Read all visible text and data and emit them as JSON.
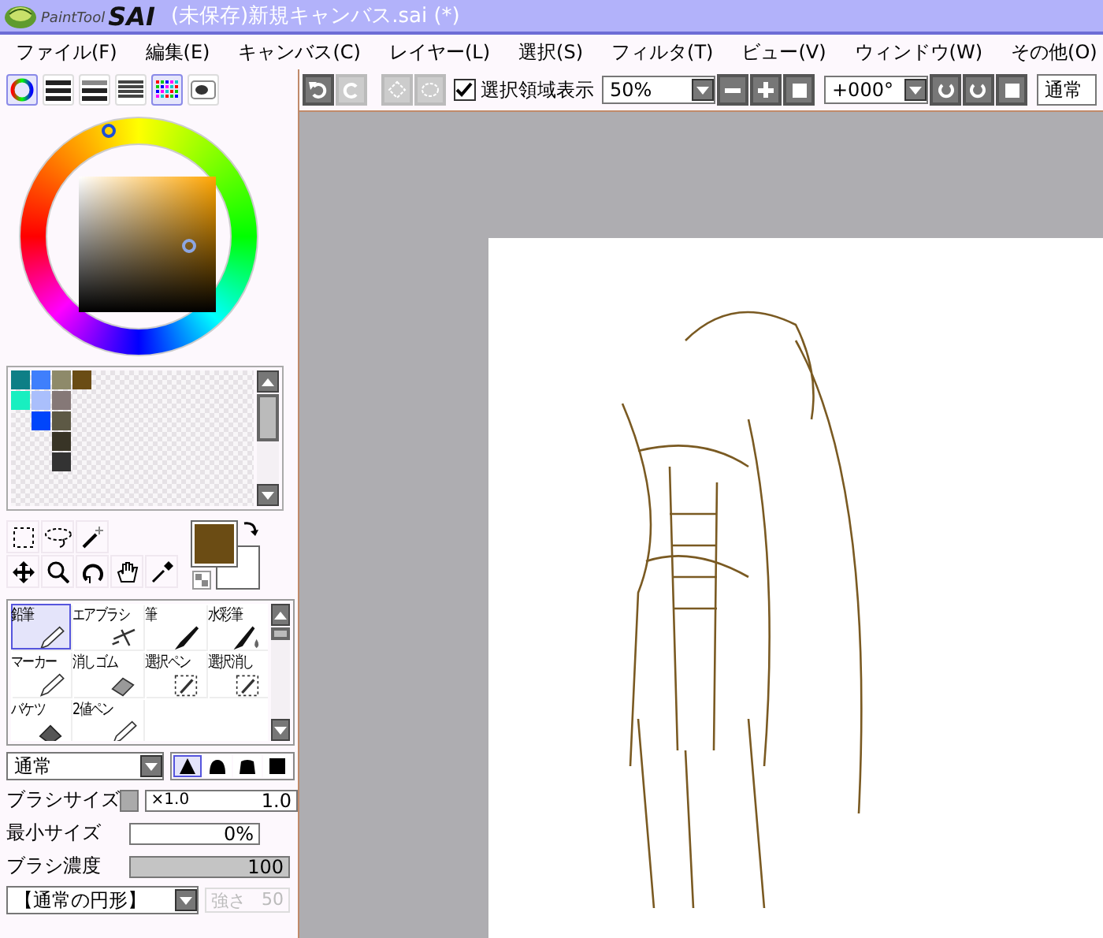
{
  "window": {
    "title": "(未保存)新規キャンバス.sai (*)",
    "logo_small": "PaintTool",
    "logo_large": "SAI"
  },
  "menu": [
    "ファイル(F)",
    "編集(E)",
    "キャンバス(C)",
    "レイヤー(L)",
    "選択(S)",
    "フィルタ(T)",
    "ビュー(V)",
    "ウィンドウ(W)",
    "その他(O)"
  ],
  "panel_tabs": [
    {
      "kind": "wheel",
      "selected": true
    },
    {
      "kind": "rgb",
      "selected": false
    },
    {
      "kind": "hsv",
      "selected": false
    },
    {
      "kind": "mixer",
      "selected": false
    },
    {
      "kind": "swatches",
      "selected": true
    },
    {
      "kind": "scratch",
      "selected": false
    }
  ],
  "palette": [
    [
      {
        "kind": "swatch",
        "color": "#0e7f86"
      },
      {
        "kind": "swatch",
        "color": "#3f7ffc"
      },
      {
        "kind": "swatch",
        "color": "#8e8a6a"
      },
      {
        "kind": "swatch",
        "color": "#6a4c14"
      }
    ],
    [
      {
        "kind": "swatch",
        "color": "#18efc0"
      },
      {
        "kind": "swatch",
        "color": "#aabffc"
      },
      {
        "kind": "swatch",
        "color": "#857877"
      }
    ],
    [
      {
        "kind": "empty"
      },
      {
        "kind": "swatch",
        "color": "#0045fb"
      },
      {
        "kind": "swatch",
        "color": "#5d5945"
      }
    ],
    [
      {
        "kind": "empty"
      },
      {
        "kind": "empty"
      },
      {
        "kind": "swatch",
        "color": "#383426"
      }
    ],
    [
      {
        "kind": "empty"
      },
      {
        "kind": "empty"
      },
      {
        "kind": "swatch",
        "color": "#333333"
      }
    ]
  ],
  "tools": [
    {
      "kind": "rect-select"
    },
    {
      "kind": "lasso"
    },
    {
      "kind": "wand"
    },
    {
      "kind": "empty"
    },
    {
      "kind": "empty"
    },
    {
      "kind": "move"
    },
    {
      "kind": "zoom"
    },
    {
      "kind": "rotate"
    },
    {
      "kind": "hand"
    },
    {
      "kind": "eyedropper"
    }
  ],
  "brushes": [
    {
      "label": "鉛筆",
      "kind": "pencil",
      "selected": true
    },
    {
      "label": "エアブラシ",
      "kind": "airbrush",
      "selected": false
    },
    {
      "label": "筆",
      "kind": "brush",
      "selected": false
    },
    {
      "label": "水彩筆",
      "kind": "watercolor",
      "selected": false
    },
    {
      "label": "マーカー",
      "kind": "pencil",
      "selected": false
    },
    {
      "label": "消しゴム",
      "kind": "eraser",
      "selected": false
    },
    {
      "label": "選択ペン",
      "kind": "selpen",
      "selected": false
    },
    {
      "label": "選択消し",
      "kind": "selerase",
      "selected": false
    },
    {
      "label": "バケツ",
      "kind": "bucket",
      "selected": false
    },
    {
      "label": "2値ペン",
      "kind": "pencil",
      "selected": false
    }
  ],
  "blend_mode": "通常",
  "brush_shapes": [
    {
      "selected": true
    },
    {
      "selected": false
    },
    {
      "selected": false
    },
    {
      "selected": false
    }
  ],
  "brush_size": {
    "label": "ブラシサイズ",
    "multiplier": "×1.0",
    "value": "1.0"
  },
  "min_size": {
    "label": "最小サイズ",
    "value": "0%",
    "level": 0
  },
  "density": {
    "label": "ブラシ濃度",
    "value": "100",
    "level": 1
  },
  "shape": {
    "value": "【通常の円形】",
    "strength_label": "強さ",
    "strength_value": "50",
    "disabled": true
  },
  "toolbar": {
    "show_selection": {
      "label": "選択領域表示",
      "checked": true
    },
    "zoom": "50%",
    "rotation": "+000°",
    "blend": "通常"
  }
}
